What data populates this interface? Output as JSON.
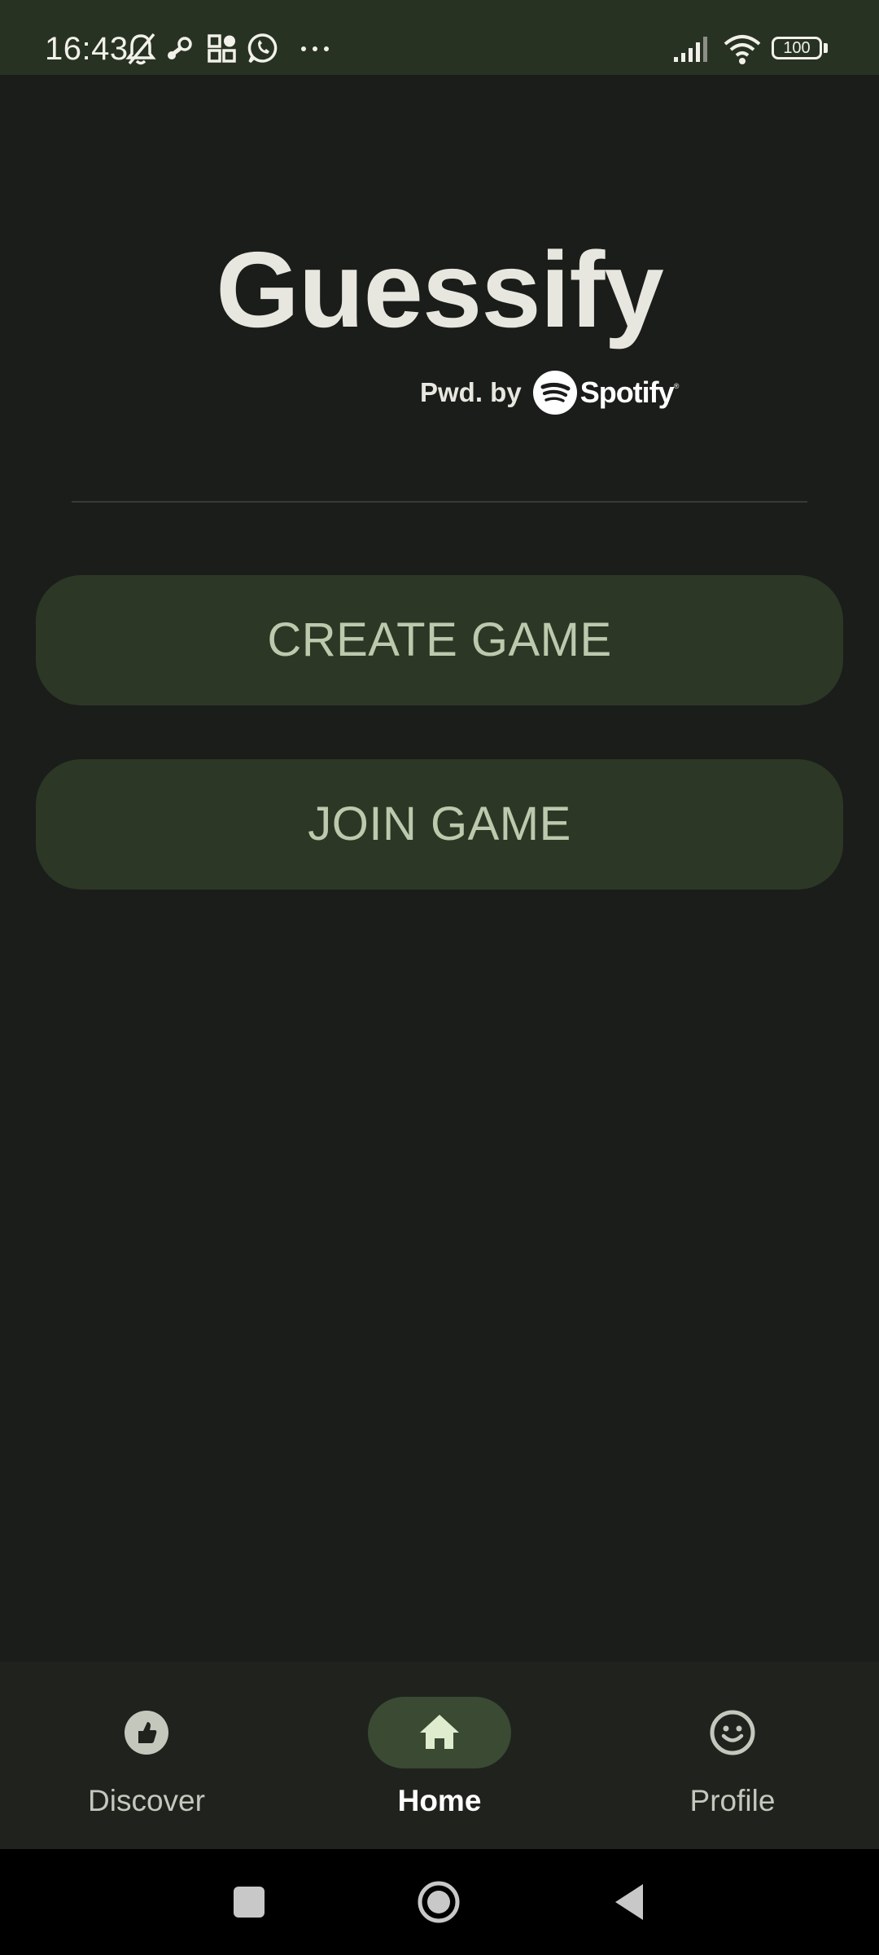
{
  "status_bar": {
    "time": "16:43",
    "battery": "100",
    "icons": [
      "bell-off-icon",
      "steam-icon",
      "app-grid-icon",
      "whatsapp-icon",
      "more-dots-icon",
      "signal-icon",
      "wifi-icon",
      "battery-icon"
    ]
  },
  "header": {
    "title": "Guessify",
    "powered_by": "Pwd. by",
    "brand": "Spotify",
    "brand_mark": "®"
  },
  "actions": {
    "create_label": "CREATE GAME",
    "join_label": "JOIN GAME"
  },
  "bottom_nav": {
    "items": [
      {
        "label": "Discover",
        "icon": "thumbs-up-icon",
        "active": false
      },
      {
        "label": "Home",
        "icon": "home-icon",
        "active": true
      },
      {
        "label": "Profile",
        "icon": "smiley-face-icon",
        "active": false
      }
    ]
  },
  "colors": {
    "background": "#1b1d1a",
    "status_bar": "#283223",
    "button_bg": "#2c3725",
    "button_text": "#bcc9ad",
    "nav_active_pill": "#3a4a33",
    "title_text": "#e8e7df"
  }
}
